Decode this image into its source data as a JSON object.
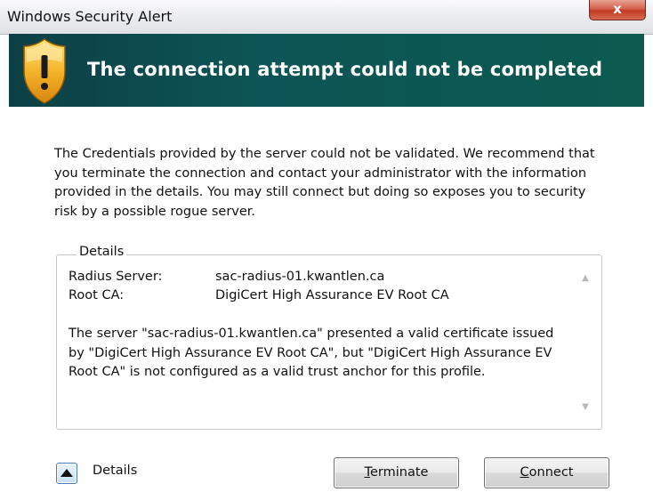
{
  "window": {
    "title": "Windows Security Alert",
    "close_label": "x"
  },
  "banner": {
    "title": "The connection attempt could not be completed",
    "icon": "warning-shield-icon"
  },
  "message": "The Credentials provided by the server could not be validated. We recommend that you terminate the connection and contact your administrator with the information provided in the details. You may still connect but doing so exposes you to security risk by a possible rogue server.",
  "details": {
    "legend": "Details",
    "radius_label": "Radius Server:",
    "radius_value": "sac-radius-01.kwantlen.ca",
    "rootca_label": "Root CA:",
    "rootca_value": "DigiCert High Assurance EV Root CA",
    "paragraph": "The server \"sac-radius-01.kwantlen.ca\" presented a valid certificate issued by \"DigiCert High Assurance EV Root CA\", but \"DigiCert High Assurance EV Root CA\" is not configured as a valid trust anchor for this profile."
  },
  "footer": {
    "details_toggle_label": "Details",
    "terminate_mnemonic": "T",
    "terminate_rest": "erminate",
    "connect_mnemonic": "C",
    "connect_rest": "onnect"
  },
  "colors": {
    "banner": "#0d5556",
    "close": "#c23a25"
  }
}
